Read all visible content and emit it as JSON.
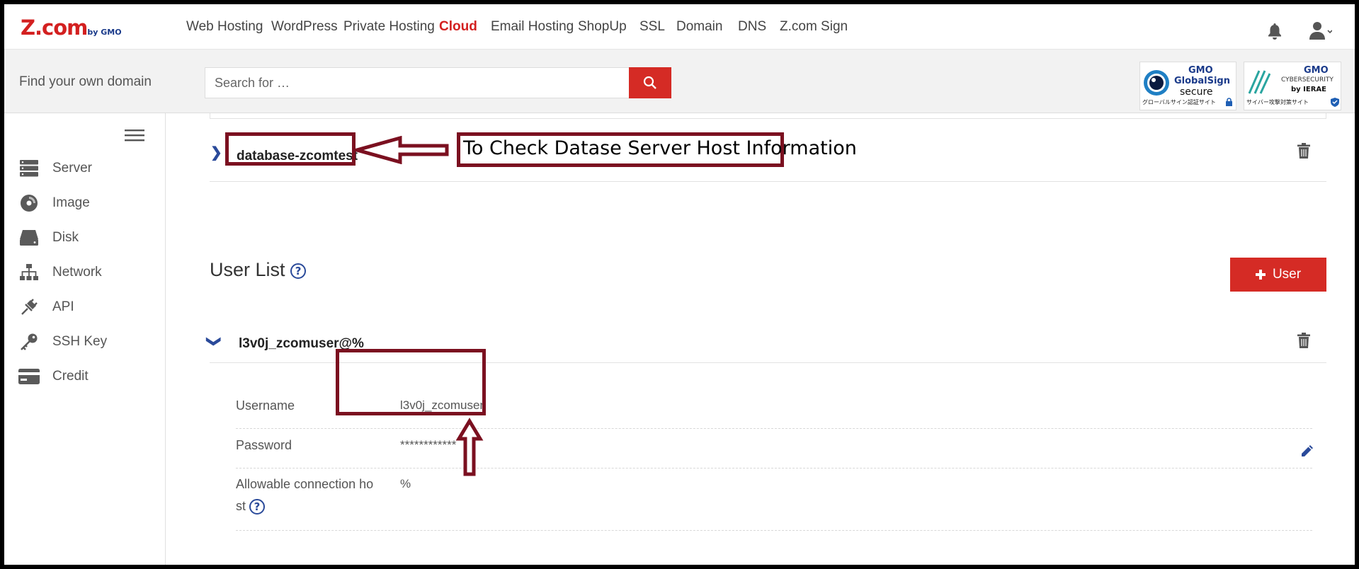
{
  "logo": {
    "text": "Z.com",
    "suffix": "by GMO"
  },
  "topnav": {
    "items": [
      {
        "label": "Web Hosting"
      },
      {
        "label": "WordPress"
      },
      {
        "label": "Private Hosting"
      },
      {
        "label": "Cloud",
        "active": true
      },
      {
        "label": "Email Hosting"
      },
      {
        "label": "ShopUp"
      },
      {
        "label": "SSL"
      },
      {
        "label": "Domain"
      },
      {
        "label": "DNS"
      },
      {
        "label": "Z.com Sign"
      }
    ],
    "icons": [
      "bell-icon",
      "user-icon",
      "chevron-down-icon"
    ]
  },
  "search": {
    "heading": "Find your own domain",
    "placeholder": "Search for …"
  },
  "badges": {
    "globalsign": {
      "brand": "GMO",
      "name": "GlobalSign",
      "sub": "secure",
      "caption": "グローバルサイン認証サイト"
    },
    "cybersecurity": {
      "brand": "GMO",
      "name": "CYBERSECURITY",
      "sub": "by IERAE",
      "caption": "サイバー攻撃対策サイト"
    }
  },
  "sidebar": {
    "items": [
      {
        "label": "Server",
        "icon": "server-icon"
      },
      {
        "label": "Image",
        "icon": "disc-icon"
      },
      {
        "label": "Disk",
        "icon": "disk-icon"
      },
      {
        "label": "Network",
        "icon": "network-icon"
      },
      {
        "label": "API",
        "icon": "plug-icon"
      },
      {
        "label": "SSH Key",
        "icon": "key-icon"
      },
      {
        "label": "Credit",
        "icon": "credit-card-icon"
      }
    ]
  },
  "database": {
    "name": "database-zcomtest"
  },
  "user_list": {
    "title": "User List",
    "help": "?",
    "add_button": "User",
    "user": {
      "name": "l3v0j_zcomuser@%",
      "fields": [
        {
          "label": "Username",
          "value": "l3v0j_zcomuser"
        },
        {
          "label": "Password",
          "value": "************"
        },
        {
          "label_line1": "Allowable connection ho",
          "label_line2": "st",
          "value": "%"
        }
      ]
    }
  },
  "annotation": {
    "text": "To Check Datase Server Host Information"
  },
  "colors": {
    "accent": "#d52b25",
    "annotation": "#7b1020",
    "link": "#2a4a9a"
  }
}
